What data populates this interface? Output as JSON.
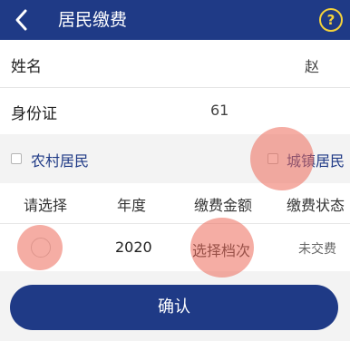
{
  "header": {
    "title": "居民缴费",
    "help_label": "?"
  },
  "form": {
    "name_label": "姓名",
    "name_value": "赵",
    "id_label": "身份证",
    "id_value": "61"
  },
  "resident_type": {
    "option_rural": "农村居民",
    "option_urban": "城镇居民"
  },
  "table": {
    "headers": [
      "请选择",
      "年度",
      "缴费金额",
      "缴费状态"
    ],
    "rows": [
      {
        "year": "2020",
        "amount": "选择档次",
        "status": "未交费"
      }
    ]
  },
  "actions": {
    "confirm_label": "确认"
  },
  "colors": {
    "primary": "#1f3a86",
    "help": "#f4d23a",
    "touch_highlight": "#ec6a5a"
  }
}
